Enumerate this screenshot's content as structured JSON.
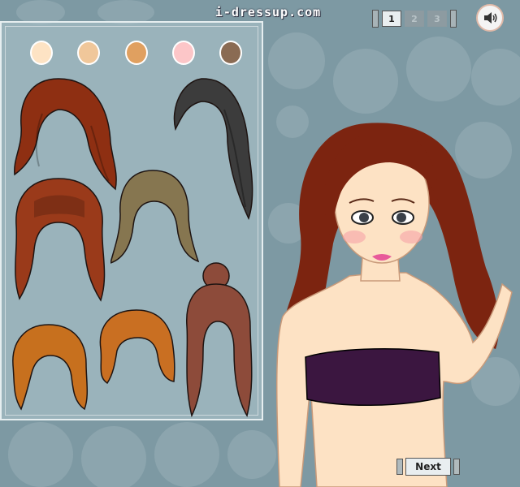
{
  "site": {
    "title": "i-dressup.com"
  },
  "step_nav": {
    "steps": [
      {
        "label": "1",
        "state": "active"
      },
      {
        "label": "2",
        "state": "inactive"
      },
      {
        "label": "3",
        "state": "inactive"
      }
    ]
  },
  "sound": {
    "icon": "speaker-icon"
  },
  "skin_tones": [
    {
      "name": "skin-tone-fair",
      "color": "#fde3c4"
    },
    {
      "name": "skin-tone-light",
      "color": "#f0c79a"
    },
    {
      "name": "skin-tone-tan",
      "color": "#e0a060"
    },
    {
      "name": "skin-tone-pink",
      "color": "#fcc6c8"
    },
    {
      "name": "skin-tone-dark",
      "color": "#8a6b53"
    }
  ],
  "hairstyles": [
    {
      "name": "hair-wavy-auburn",
      "color": "#8e2f12"
    },
    {
      "name": "hair-long-black",
      "color": "#3c3c3c"
    },
    {
      "name": "hair-curly-bangs-auburn",
      "color": "#9a3a1a"
    },
    {
      "name": "hair-straight-ash-brown",
      "color": "#867650"
    },
    {
      "name": "hair-bun-brown",
      "color": "#8d4b3a"
    },
    {
      "name": "hair-bob-ginger",
      "color": "#c7701e"
    },
    {
      "name": "hair-short-curly-ginger",
      "color": "#c96f22"
    }
  ],
  "model": {
    "hair_color": "#7c2410",
    "skin_color": "#fde2c4",
    "top_color": "#3b1640"
  },
  "next_button": {
    "label": "Next"
  }
}
